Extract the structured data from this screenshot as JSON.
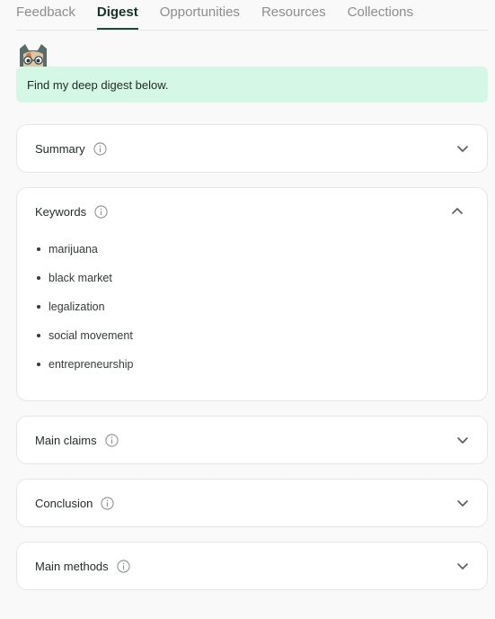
{
  "tabs": [
    {
      "label": "Feedback",
      "active": false
    },
    {
      "label": "Digest",
      "active": true
    },
    {
      "label": "Opportunities",
      "active": false
    },
    {
      "label": "Resources",
      "active": false
    },
    {
      "label": "Collections",
      "active": false
    }
  ],
  "message": {
    "text": "Find my deep digest below."
  },
  "sections": {
    "summary": {
      "title": "Summary",
      "expanded": false
    },
    "keywords": {
      "title": "Keywords",
      "expanded": true,
      "items": [
        "marijuana",
        "black market",
        "legalization",
        "social movement",
        "entrepreneurship"
      ]
    },
    "main_claims": {
      "title": "Main claims",
      "expanded": false
    },
    "conclusion": {
      "title": "Conclusion",
      "expanded": false
    },
    "main_methods": {
      "title": "Main methods",
      "expanded": false
    }
  },
  "colors": {
    "accent": "#1d4a3d",
    "bubble": "#d4f7e6",
    "tab_inactive": "#8a8f8d"
  },
  "icons": {
    "info": "info-circle-icon",
    "collapsed": "chevron-down-icon",
    "expanded": "chevron-up-icon",
    "avatar": "cat-avatar-icon"
  }
}
